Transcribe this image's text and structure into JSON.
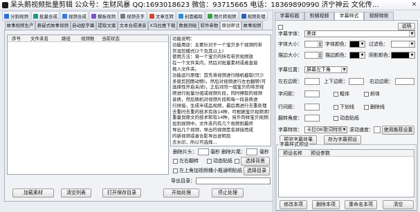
{
  "window": {
    "title": "呆头鹅视频批量剪辑 公众号：生财风暴 QQ:1693018623 微信：93715665 电话：18369890990 济宁神云 文化传…",
    "icon": "goose-logo-icon",
    "close_icon": "close-icon"
  },
  "toolbar": {
    "items": [
      {
        "label": "分割视频",
        "icon": "split-video-icon",
        "icon_color": "#2f6fd1"
      },
      {
        "label": "批量合成",
        "icon": "batch-merge-icon",
        "icon_color": "#1f9a8a"
      },
      {
        "label": "视频合成",
        "icon": "video-merge-icon",
        "icon_color": "#3a7ad8"
      },
      {
        "label": "模板视频",
        "icon": "template-video-icon",
        "icon_color": "#7b52c7"
      },
      {
        "label": "视频去字",
        "icon": "remove-text-icon",
        "icon_color": "#7a7a7a"
      },
      {
        "label": "文章互转",
        "icon": "text-convert-icon",
        "icon_color": "#d2452f"
      },
      {
        "label": "封面截取",
        "icon": "cover-capture-icon",
        "icon_color": "#2f8fd1"
      },
      {
        "label": "图片转视频",
        "icon": "image-to-video-icon",
        "icon_color": "#3aa04a"
      },
      {
        "label": "视频处理",
        "icon": "video-process-icon",
        "icon_color": "#2b5fb8"
      }
    ]
  },
  "tabs": {
    "items": [
      {
        "label": "故事视频生产"
      },
      {
        "label": "悬疑式故事视频"
      },
      {
        "label": "自动配字幕"
      },
      {
        "label": "提取文案"
      },
      {
        "label": "文本合成语音"
      },
      {
        "label": "X马拉推下载"
      },
      {
        "label": "数据测绘"
      },
      {
        "label": "软件参数"
      },
      {
        "label": "原创帮话"
      },
      {
        "label": "故事视频"
      }
    ],
    "active_index": 8
  },
  "file_list": {
    "columns": [
      "序号",
      "文件夹名",
      "路径",
      "视频数",
      "当前状态"
    ],
    "rows": []
  },
  "help": {
    "lines": [
      "功能说明：",
      "功能用途：主要针对于一个宝贝多个视频的带",
      "货混剪模式(2个及其以上)",
      "使用方法：将一个宝贝的所有带货视频放",
      "在一个文件夹内，然后对批量素材或者直接",
      "拖入文件夹。",
      "功能运行原理：首先将视频进行随机截取(只少",
      "多般剪回图动物)，然后对视频进行左右翻转(可",
      "选择性开启关闭)，之后对同一组宝贝的带货视",
      "频进行批量分组或视频片段，同时擦取的视频",
      "音质，然后随机对视频片段和每一段音质进",
      "行拼接，生成半成品视频，最后再进行去重处理",
      "去重时去重的技术有效14种，可根据宝贝视频添加",
      "重量到原文的技术和有14种，另外同样宝贝视频添",
      "加到视频中。文件夹内有几个视频则最终",
      "导出几个视频，导出的视频是名拼接而成",
      "的新视频或者合影导出说明及",
      "去水印，所以可选择..."
    ]
  },
  "options": {
    "trim_head_label": "删除片头：",
    "trim_head_value": "",
    "trim_head_unit": "毫秒",
    "trim_tail_label": "删除片尾：",
    "trim_tail_value": "",
    "trim_tail_unit": "毫秒",
    "flip_label": "左右翻转",
    "sticker_label": "动态贴纸",
    "bg_button": "选择背景",
    "corner_sticker_label": "左上角加视频播小瓶通明贴纸",
    "choose_dir_button": "选择目录"
  },
  "export": {
    "label": "导出目录：",
    "value": ""
  },
  "actions": {
    "load": "加载素材",
    "clear": "清空列表",
    "open_dir": "打开保存目录",
    "start": "开始处理",
    "stop": "停止处理"
  },
  "right_panel": {
    "tabs": [
      {
        "label": "字幕标题"
      },
      {
        "label": "剪辑视频"
      },
      {
        "label": "字幕样式"
      },
      {
        "label": "视频特效"
      }
    ],
    "active_tab_index": 2,
    "help_button": "说明",
    "font_label": "字幕字体：",
    "font_value": "黑体",
    "size_label": "字体大小：",
    "size_value": "",
    "font_color_label": "字体颜色：",
    "font_color": "#000000",
    "filter_color_label": "过滤色：",
    "filter_color": "#ffffff",
    "stroke_size_label": "描边大小：",
    "stroke_size_value": "",
    "stroke_color_label": "描边颜色：",
    "stroke_color": "#000000",
    "shadow_color_label": "阴影颜色：",
    "shadow_color": "#000000",
    "position_label": "字幕位置：",
    "position_value": "屏幕左下角",
    "lr_margin_label": "左右边距：",
    "lr_margin_value": "",
    "tb_margin_label": "上下边距：",
    "tb_margin_value": "",
    "right_margin_label": "右边边距：",
    "right_margin_value": "",
    "char_spacing_label": "字间距：",
    "char_spacing_value": "",
    "bold_label": "粗体",
    "italic_label": "斜体",
    "line_spacing_label": "行间距：",
    "line_spacing_value": "",
    "underline_label": "下划线",
    "strike_label": "删除线",
    "rotation_label": "翻转角度：",
    "rotation_value": "",
    "dynamic_sticker_label": "动态贴纸",
    "effect_label": "字幕特效：",
    "effect_value": "卡拉OK歌词特效",
    "scroll_speed_label": "滚动速度：",
    "scroll_speed_value": "",
    "recommend_button": "使用推荐设置",
    "preview_button": "预览字幕效果",
    "save_preset_button": "存为字幕预设",
    "presets": {
      "title": "字幕样式预设",
      "columns": [
        "预设名称",
        "预设参数"
      ],
      "rows": []
    },
    "preset_actions": {
      "edit": "修改本项",
      "delete": "删除本项",
      "rename": "重命名本项",
      "clear": "清空"
    }
  }
}
